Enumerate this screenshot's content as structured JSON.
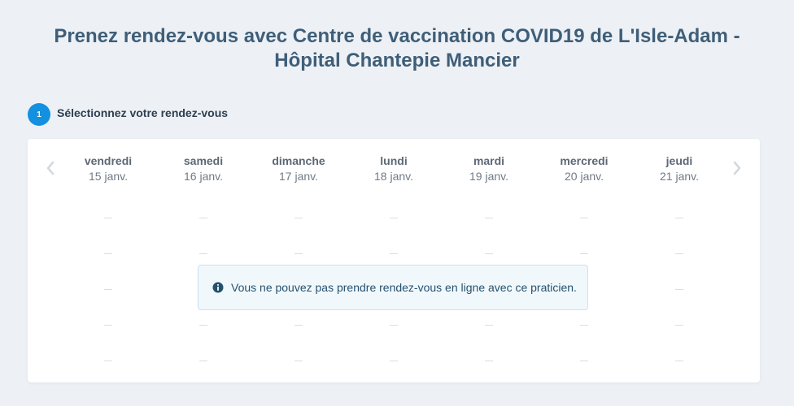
{
  "header": {
    "title_line1": "Prenez rendez-vous avec Centre de vaccination COVID19 de L'Isle-Adam -",
    "title_line2": "Hôpital Chantepie Mancier"
  },
  "step": {
    "number": "1",
    "label": "Sélectionnez votre rendez-vous"
  },
  "calendar": {
    "days": [
      {
        "name": "vendredi",
        "date": "15 janv."
      },
      {
        "name": "samedi",
        "date": "16 janv."
      },
      {
        "name": "dimanche",
        "date": "17 janv."
      },
      {
        "name": "lundi",
        "date": "18 janv."
      },
      {
        "name": "mardi",
        "date": "19 janv."
      },
      {
        "name": "mercredi",
        "date": "20 janv."
      },
      {
        "name": "jeudi",
        "date": "21 janv."
      }
    ],
    "prev_icon": "chevron-left-icon",
    "next_icon": "chevron-right-icon"
  },
  "alert": {
    "icon": "info-icon",
    "text": "Vous ne pouvez pas prendre rendez-vous en ligne avec ce praticien."
  },
  "colors": {
    "background": "#edf1f6",
    "title": "#3f5e78",
    "accent": "#1490e0",
    "alert_bg": "#f1f8fc",
    "alert_text": "#24516e"
  }
}
